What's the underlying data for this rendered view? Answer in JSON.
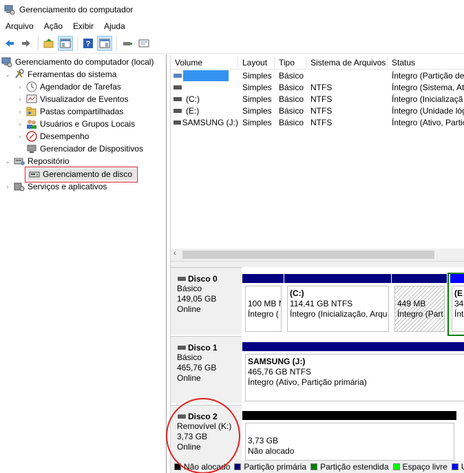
{
  "window": {
    "title": "Gerenciamento do computador"
  },
  "menu": [
    "Arquivo",
    "Ação",
    "Exibir",
    "Ajuda"
  ],
  "toolbar": {
    "icons": [
      "back-icon",
      "forward-icon",
      "up-folder-icon",
      "show-hide-tree-icon",
      "help-icon",
      "properties-pane-icon",
      "connect-icon",
      "console-icon"
    ]
  },
  "tree": {
    "root": "Gerenciamento do computador (local)",
    "tools": "Ferramentas do sistema",
    "task_scheduler": "Agendador de Tarefas",
    "event_viewer": "Visualizador de Eventos",
    "shared_folders": "Pastas compartilhadas",
    "users_groups": "Usuários e Grupos Locais",
    "performance": "Desempenho",
    "device_manager": "Gerenciador de Dispositivos",
    "storage": "Repositório",
    "disk_management": "Gerenciamento de disco",
    "services": "Serviços e aplicativos"
  },
  "volume_list": {
    "headers": [
      "Volume",
      "Layout",
      "Tipo",
      "Sistema de Arquivos",
      "Status"
    ],
    "rows": [
      {
        "volume": "",
        "layout": "Simples",
        "type": "Básico",
        "fs": "",
        "status": "Íntegro (Partição de"
      },
      {
        "volume": "",
        "layout": "Simples",
        "type": "Básico",
        "fs": "NTFS",
        "status": "Íntegro (Sistema, At"
      },
      {
        "volume": "(C:)",
        "layout": "Simples",
        "type": "Básico",
        "fs": "NTFS",
        "status": "Íntegro (Inicializaçã"
      },
      {
        "volume": "(E:)",
        "layout": "Simples",
        "type": "Básico",
        "fs": "NTFS",
        "status": "Íntegro (Unidade lóg"
      },
      {
        "volume": "SAMSUNG (J:)",
        "layout": "Simples",
        "type": "Básico",
        "fs": "NTFS",
        "status": "Íntegro (Ativo, Partic"
      }
    ]
  },
  "disks": [
    {
      "name": "Disco 0",
      "type": "Básico",
      "size": "149,05 GB",
      "state": "Online",
      "partitions": [
        {
          "title": "",
          "size": "100 MB N",
          "status": "Íntegro ("
        },
        {
          "title": "(C:)",
          "size": "114,41 GB NTFS",
          "status": "Íntegro (Inicialização, Arqu"
        },
        {
          "title": "",
          "size": "449 MB",
          "status": "Íntegro (Part"
        },
        {
          "title": "(E",
          "size": "34,",
          "status": "Ínt"
        }
      ]
    },
    {
      "name": "Disco 1",
      "type": "Básico",
      "size": "465,76 GB",
      "state": "Online",
      "partitions": [
        {
          "title": "SAMSUNG  (J:)",
          "size": "465,76 GB NTFS",
          "status": "Íntegro (Ativo, Partição primária)"
        }
      ]
    },
    {
      "name": "Disco 2",
      "type": "Removível (K:)",
      "size": "3,73 GB",
      "state": "Online",
      "partitions": [
        {
          "title": "",
          "size": "3,73 GB",
          "status": "Não alocado"
        }
      ]
    }
  ],
  "legend": [
    {
      "label": "Não alocado",
      "color": "#000000"
    },
    {
      "label": "Partição primária",
      "color": "#000080"
    },
    {
      "label": "Partição estendida",
      "color": "#008000"
    },
    {
      "label": "Espaço livre",
      "color": "#00ff00"
    },
    {
      "label": "U",
      "color": "#0000ff"
    }
  ]
}
